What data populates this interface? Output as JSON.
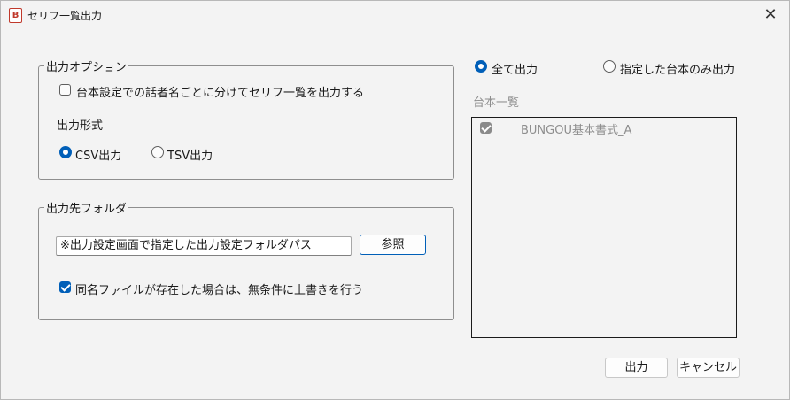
{
  "window": {
    "title": "セリフ一覧出力",
    "icon_letter": "B",
    "close_symbol": "✕"
  },
  "output_options": {
    "legend": "出力オプション",
    "split_by_speaker_label": "台本設定での話者名ごとに分けてセリフ一覧を出力する",
    "split_by_speaker_checked": false,
    "format_heading": "出力形式",
    "formats": [
      {
        "label": "CSV出力",
        "selected": true
      },
      {
        "label": "TSV出力",
        "selected": false
      }
    ]
  },
  "output_folder": {
    "legend": "出力先フォルダ",
    "path_value": "※出力設定画面で指定した出力設定フォルダパス",
    "browse_label": "参照",
    "overwrite_label": "同名ファイルが存在した場合は、無条件に上書きを行う",
    "overwrite_checked": true
  },
  "scope": {
    "all_label": "全て出力",
    "all_selected": true,
    "selected_label": "指定した台本のみ出力",
    "selected_selected": false
  },
  "script_list": {
    "heading": "台本一覧",
    "items": [
      {
        "label": "BUNGOU基本書式_A",
        "checked": true
      }
    ]
  },
  "buttons": {
    "output_label": "出力",
    "cancel_label": "キャンセル"
  },
  "colors": {
    "accent": "#005fb8",
    "disabled_text": "#8e8e8e"
  }
}
